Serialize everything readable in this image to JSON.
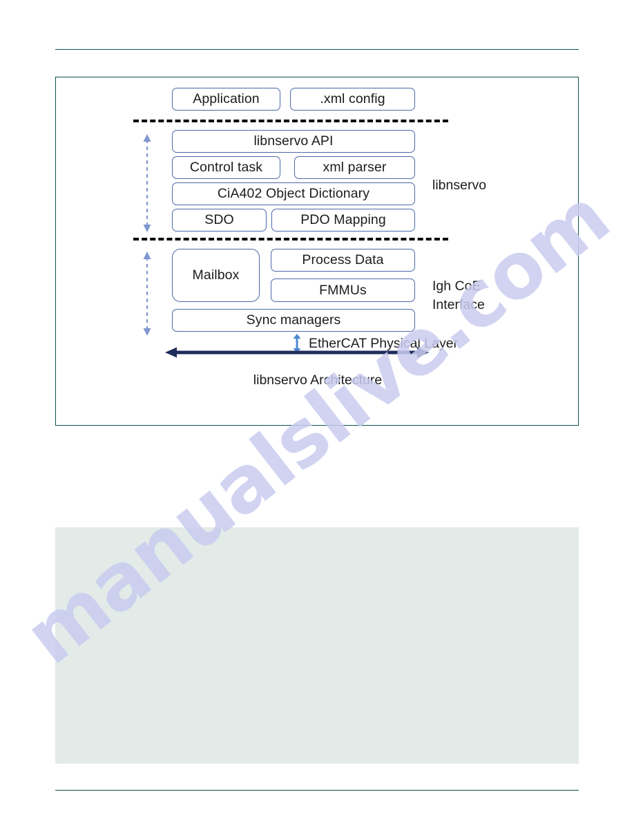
{
  "page": {
    "watermark_text": "manualslive.com",
    "background_color": "#ffffff",
    "rule_color": "#0d4f4a",
    "frame_color": "#0d4f4a",
    "box_border_color": "#4a68a8",
    "dashed_color": "#000000",
    "vertical_arrow_color": "#8096d0",
    "horizontal_arrow_color": "#1f2d5c",
    "grey_block_color": "#e3ebe9"
  },
  "figure": {
    "caption": "libnservo Architecture",
    "top_layer": {
      "boxes": [
        {
          "label": "Application"
        },
        {
          "label": ".xml config"
        }
      ]
    },
    "libnservo_layer": {
      "side_label": "libnservo",
      "rows": [
        {
          "boxes": [
            {
              "label": "libnservo API"
            }
          ]
        },
        {
          "boxes": [
            {
              "label": "Control task"
            },
            {
              "label": "xml parser"
            }
          ]
        },
        {
          "boxes": [
            {
              "label": "CiA402 Object Dictionary"
            }
          ]
        },
        {
          "boxes": [
            {
              "label": "SDO"
            },
            {
              "label": "PDO Mapping"
            }
          ]
        }
      ]
    },
    "igh_layer": {
      "side_label_line1": "Igh CoE",
      "side_label_line2": "Interface",
      "boxes": [
        {
          "label": "Mailbox"
        },
        {
          "label": "Process Data"
        },
        {
          "label": "FMMUs"
        },
        {
          "label": "Sync managers"
        }
      ]
    },
    "physical_layer": {
      "label": "EtherCAT Physical Layer"
    }
  }
}
